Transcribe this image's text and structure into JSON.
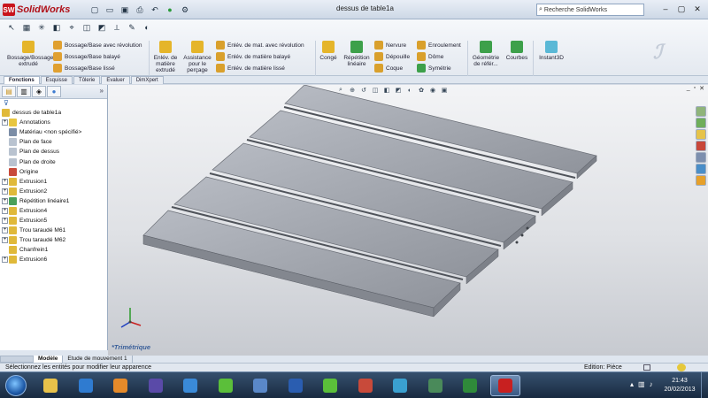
{
  "app": {
    "logo_text": "SolidWorks",
    "logo_mark": "SW",
    "document_title": "dessus de table1a",
    "search_placeholder": "Recherche SolidWorks",
    "window_controls": [
      "minimize-icon",
      "restore-icon",
      "close-icon"
    ]
  },
  "quick_access": [
    "new-icon",
    "open-icon",
    "save-icon",
    "print-icon",
    "undo-icon",
    "rebuild-icon",
    "options-icon"
  ],
  "command_manager": {
    "big_buttons": [
      {
        "label": "Bossage/Bossage extrudé",
        "color": "#e5b52a"
      },
      {
        "label": "Enlév. de matière extrudé",
        "color": "#e5b52a"
      },
      {
        "label": "Assistance pour le perçage",
        "color": "#e5b52a"
      },
      {
        "label": "Congé",
        "color": "#e5b52a"
      },
      {
        "label": "Répétition linéaire",
        "color": "#3da04a"
      },
      {
        "label": "Géométrie de référ...",
        "color": "#3da04a"
      },
      {
        "label": "Courbes",
        "color": "#3da04a"
      },
      {
        "label": "Instant3D",
        "color": "#5ab8d6"
      }
    ],
    "small_buttons": [
      "Bossage/Base avec révolution",
      "Bossage/Base balayé",
      "Bossage/Base lissé",
      "Enlév. de mat. avec révolution",
      "Enlév. de matière balayé",
      "Enlév. de matière lissé",
      "Nervure",
      "Dépouille",
      "Coque",
      "Enroulement",
      "Dôme",
      "Symétrie"
    ]
  },
  "tabs": [
    "Fonctions",
    "Esquisse",
    "Tôlerie",
    "Evaluer",
    "DimXpert"
  ],
  "active_tab": "Fonctions",
  "feature_tree": {
    "root": "dessus de table1a",
    "items": [
      {
        "label": "Annotations",
        "expandable": true,
        "icon_color": "#e8c640"
      },
      {
        "label": "Matériau <non spécifié>",
        "expandable": false,
        "icon_color": "#7b8da6"
      },
      {
        "label": "Plan de face",
        "expandable": false,
        "icon_color": "#b9c3d0"
      },
      {
        "label": "Plan de dessus",
        "expandable": false,
        "icon_color": "#b9c3d0"
      },
      {
        "label": "Plan de droite",
        "expandable": false,
        "icon_color": "#b9c3d0"
      },
      {
        "label": "Origine",
        "expandable": false,
        "icon_color": "#c84a3a"
      },
      {
        "label": "Extrusion1",
        "expandable": true,
        "icon_color": "#e0b93a"
      },
      {
        "label": "Extrusion2",
        "expandable": true,
        "icon_color": "#e0b93a"
      },
      {
        "label": "Répétition linéaire1",
        "expandable": true,
        "icon_color": "#4aa05a"
      },
      {
        "label": "Extrusion4",
        "expandable": true,
        "icon_color": "#e0b93a"
      },
      {
        "label": "Extrusion5",
        "expandable": true,
        "icon_color": "#e0b93a"
      },
      {
        "label": "Trou taraudé M61",
        "expandable": true,
        "icon_color": "#e0b93a"
      },
      {
        "label": "Trou taraudé M62",
        "expandable": true,
        "icon_color": "#e0b93a"
      },
      {
        "label": "Chanfrein1",
        "expandable": false,
        "icon_color": "#e0b93a"
      },
      {
        "label": "Extrusion6",
        "expandable": true,
        "icon_color": "#e0b93a"
      }
    ]
  },
  "viewport": {
    "view_label": "*Trimétrique",
    "model_color": "#9fa3ab"
  },
  "model_tabs": [
    "Modèle",
    "Etude de mouvement 1"
  ],
  "status_bar": {
    "message": "Sélectionnez les entités pour modifier leur apparence",
    "edit_mode": "Edition: Pièce"
  },
  "taskbar": {
    "apps": [
      "folder-icon",
      "media-player-icon",
      "explorer-icon",
      "nero-icon",
      "ie-icon",
      "chat-icon",
      "thunderbird-icon",
      "word-icon",
      "messenger-icon",
      "paint-icon",
      "media-icon",
      "network-icon",
      "game-icon",
      "solidworks-icon"
    ],
    "clock_time": "21:43",
    "clock_date": "20/02/2013"
  }
}
